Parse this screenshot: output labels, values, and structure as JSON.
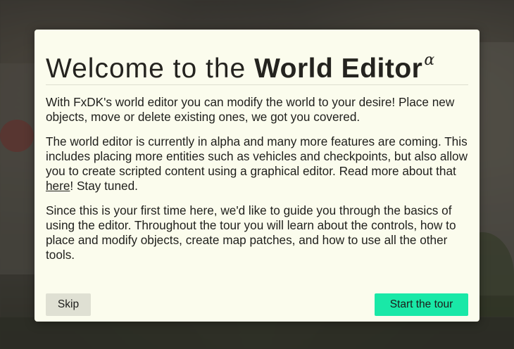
{
  "modal": {
    "title_prefix": "Welcome to the ",
    "title_strong": "World Editor",
    "title_superscript": "α",
    "paragraphs": {
      "intro": "With FxDK's world editor you can modify the world to your desire! Place new objects, move or delete existing ones, we got you covered.",
      "alpha_before_link": "The world editor is currently in alpha and many more features are coming. This includes placing more entities such as vehicles and checkpoints, but also allow you to create scripted content using a graphical editor. Read more about that ",
      "alpha_link": "here",
      "alpha_after_link": "! Stay tuned.",
      "tour": "Since this is your first time here, we'd like to guide you through the basics of using the editor. Throughout the tour you will learn about the controls, how to place and modify objects, create map patches, and how to use all the other tools."
    },
    "buttons": {
      "skip": "Skip",
      "start": "Start the tour"
    }
  },
  "colors": {
    "modal_background": "#fbfced",
    "primary_button": "#19e8a7",
    "secondary_button": "#dfe0d3",
    "text": "#1f1f1c"
  }
}
